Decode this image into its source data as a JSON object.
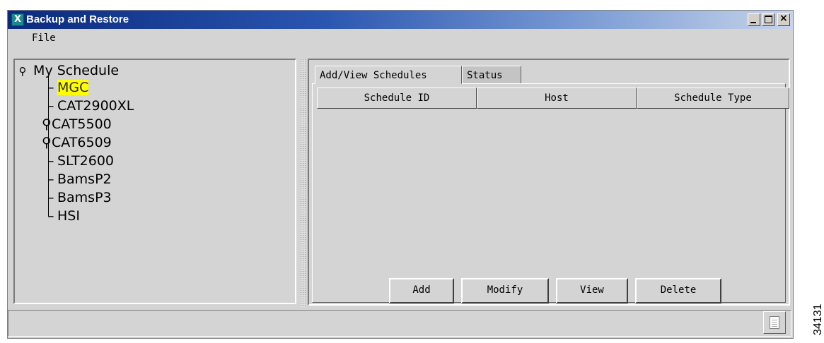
{
  "window": {
    "title": "Backup and Restore",
    "app_icon_letter": "X"
  },
  "menu": {
    "file": "File"
  },
  "tree": {
    "root": "My Schedule",
    "items": [
      {
        "label": "MGC",
        "selected": true,
        "expandable": false
      },
      {
        "label": "CAT2900XL",
        "expandable": false
      },
      {
        "label": "CAT5500",
        "expandable": true
      },
      {
        "label": "CAT6509",
        "expandable": true
      },
      {
        "label": "SLT2600",
        "expandable": false
      },
      {
        "label": "BamsP2",
        "expandable": false
      },
      {
        "label": "BamsP3",
        "expandable": false
      },
      {
        "label": "HSI",
        "expandable": false
      }
    ]
  },
  "tabs": [
    {
      "label": "Add/View Schedules",
      "active": true
    },
    {
      "label": "Status",
      "active": false
    }
  ],
  "table": {
    "columns": [
      "Schedule ID",
      "Host",
      "Schedule Type"
    ],
    "rows": []
  },
  "buttons": {
    "add": "Add",
    "modify": "Modify",
    "view": "View",
    "delete": "Delete"
  },
  "status_bar": {
    "text": ""
  },
  "figure_id": "34131",
  "colors": {
    "selection_highlight": "#ffff00",
    "title_bar": "#0a2a7e"
  }
}
